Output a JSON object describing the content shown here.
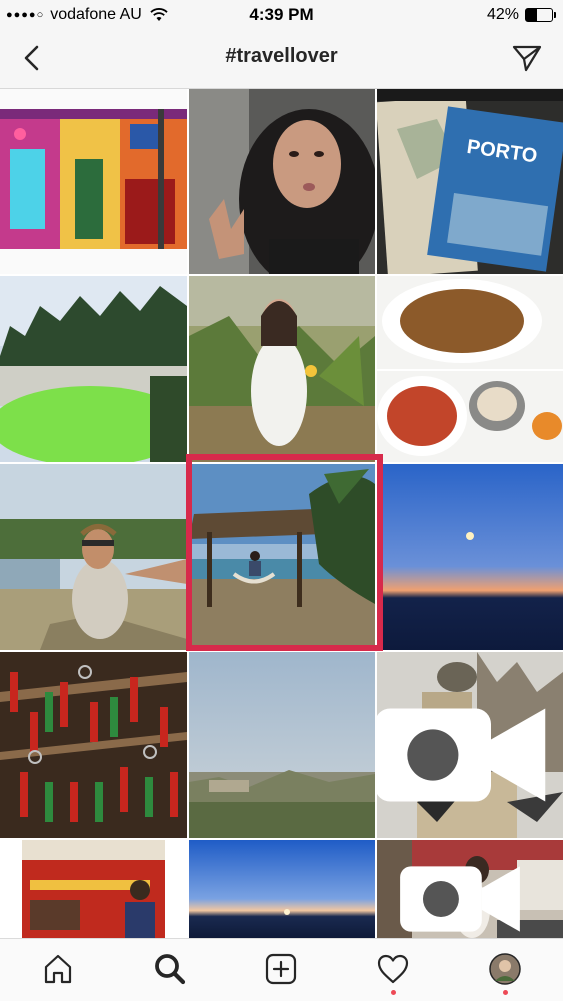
{
  "status_bar": {
    "carrier": "vodafone AU",
    "time": "4:39 PM",
    "battery_percent": "42%",
    "battery_level": 0.42,
    "signal_dots": "●●●●○"
  },
  "header": {
    "title": "#travellover",
    "back_icon": "chevron-left-icon",
    "send_icon": "paper-plane-icon"
  },
  "grid": {
    "columns": 3,
    "selected_index": 7,
    "posts": [
      {
        "subject": "colorful building facade",
        "type": "photo"
      },
      {
        "subject": "woman selfie with peace sign",
        "type": "photo"
      },
      {
        "subject": "travel diary and Porto guidebook",
        "type": "photo"
      },
      {
        "subject": "green crater lake",
        "type": "photo"
      },
      {
        "subject": "woman in white among plants",
        "type": "photo"
      },
      {
        "subject": "food collage",
        "type": "photo"
      },
      {
        "subject": "cyclist selfie on path",
        "type": "photo"
      },
      {
        "subject": "woman on beach swing under palm hut",
        "type": "photo"
      },
      {
        "subject": "sunset over landscape",
        "type": "photo"
      },
      {
        "subject": "market with red chili keychains",
        "type": "photo"
      },
      {
        "subject": "hazy city skyline",
        "type": "photo"
      },
      {
        "subject": "pigeons and statue",
        "type": "video"
      },
      {
        "subject": "colorful shop interior",
        "type": "photo"
      },
      {
        "subject": "blue sunset horizon",
        "type": "photo"
      },
      {
        "subject": "woman in kitchen",
        "type": "video"
      }
    ]
  },
  "book_text": "PORTO",
  "tab_bar": {
    "items": [
      {
        "name": "home",
        "icon": "home-icon"
      },
      {
        "name": "search",
        "icon": "search-icon",
        "active": true
      },
      {
        "name": "new-post",
        "icon": "plus-square-icon"
      },
      {
        "name": "activity",
        "icon": "heart-icon",
        "has_notification": true
      },
      {
        "name": "profile",
        "icon": "avatar-icon",
        "has_notification": true
      }
    ]
  },
  "colors": {
    "highlight": "#d72a4b",
    "notification": "#ed4956",
    "bar_bg": "#f6f6f6"
  }
}
